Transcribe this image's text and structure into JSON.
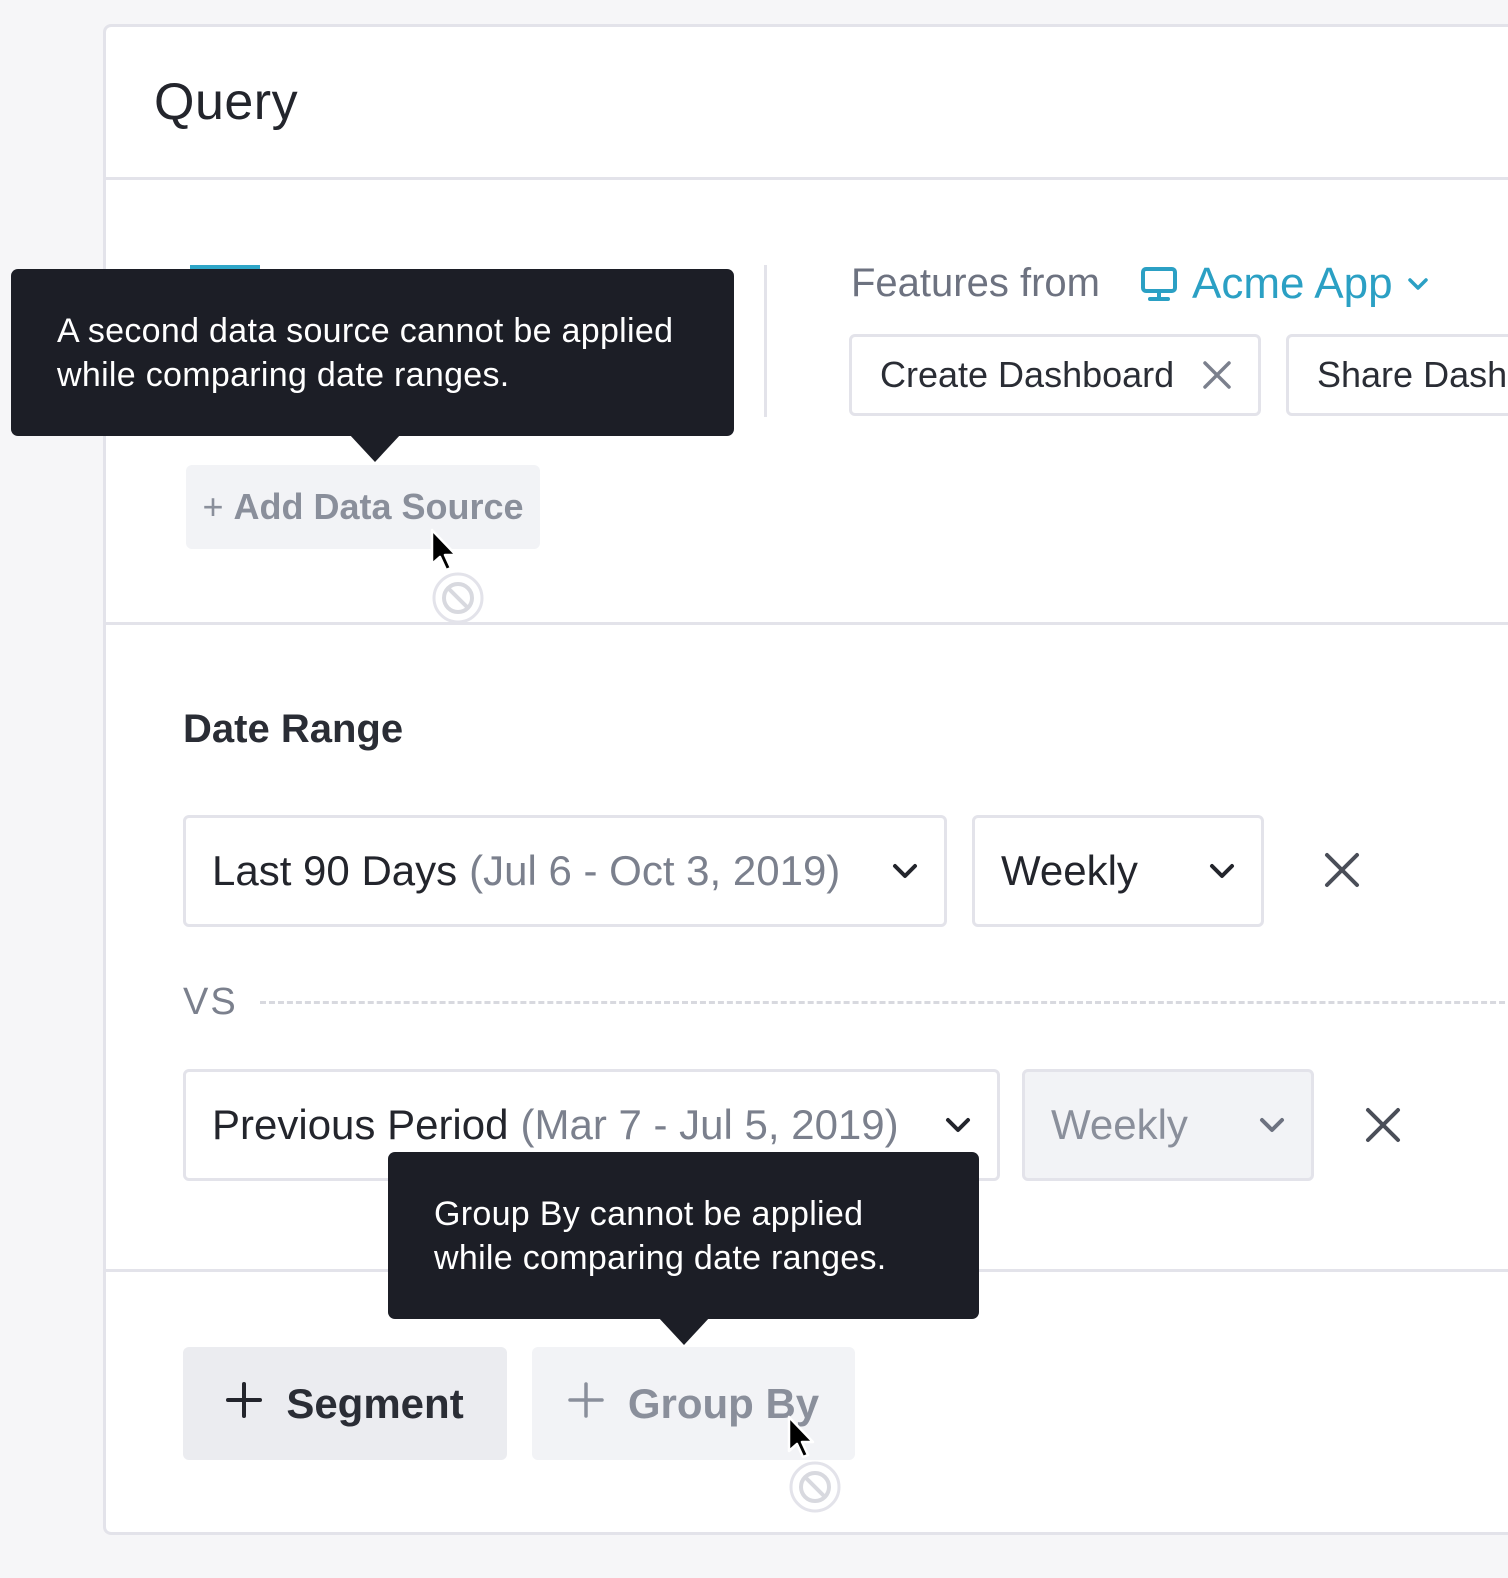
{
  "panel": {
    "title": "Query"
  },
  "features": {
    "label": "Features from",
    "app_name": "Acme App",
    "chips": [
      {
        "label": "Create Dashboard",
        "removable": true
      },
      {
        "label": "Share Dash",
        "removable": false
      }
    ]
  },
  "data_source": {
    "add_plus": "+",
    "add_label": "Add Data Source",
    "tooltip": "A second data source cannot be applied while comparing date ranges."
  },
  "date_range": {
    "title": "Date Range",
    "primary": {
      "label": "Last 90 Days",
      "dates": "(Jul 6 - Oct 3, 2019)",
      "interval": "Weekly"
    },
    "vs_label": "VS",
    "comparison": {
      "label": "Previous Period",
      "dates": "(Mar 7 - Jul 5, 2019)",
      "interval": "Weekly",
      "interval_disabled": true
    }
  },
  "actions": {
    "segment_label": "Segment",
    "group_by_label": "Group By",
    "group_by_tooltip": "Group By cannot be applied while comparing date ranges."
  },
  "colors": {
    "accent": "#2ba0c4",
    "tooltip_bg": "#1c1e26",
    "border": "#e3e3ea",
    "disabled_bg": "#f2f3f6"
  },
  "icons": {
    "app": "monitor-icon",
    "dropdown": "chevron-down-icon",
    "remove": "close-icon",
    "add": "plus-icon",
    "cursor": "not-allowed-cursor-icon"
  }
}
